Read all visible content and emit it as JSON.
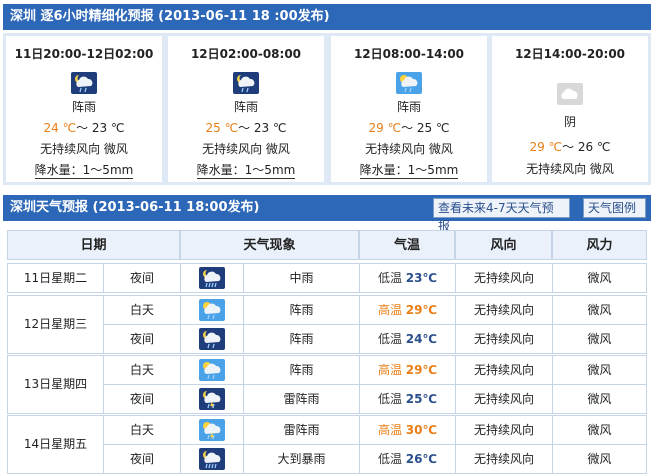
{
  "section1": {
    "title": "深圳  逐6小时精细化预报  (2013-06-11   18 :00发布)"
  },
  "periods": [
    {
      "time": "11日20:00-12日02:00",
      "weather": "阵雨",
      "temp_high": "24 ℃",
      "sep": "～",
      "temp_low": "23 ℃",
      "wind": "无持续风向 微风",
      "rain": "降水量：1～5mm",
      "icon": "shower-night-icon"
    },
    {
      "time": "12日02:00-08:00",
      "weather": "阵雨",
      "temp_high": "25 ℃",
      "sep": "～",
      "temp_low": "23 ℃",
      "wind": "无持续风向 微风",
      "rain": "降水量：1～5mm",
      "icon": "shower-night-icon"
    },
    {
      "time": "12日08:00-14:00",
      "weather": "阵雨",
      "temp_high": "29 ℃",
      "sep": "～",
      "temp_low": "25 ℃",
      "wind": "无持续风向 微风",
      "rain": "降水量：1～5mm",
      "icon": "shower-day-icon"
    },
    {
      "time": "12日14:00-20:00",
      "weather": "阴",
      "temp_high": "29 ℃",
      "sep": "～",
      "temp_low": "26 ℃",
      "wind": "无持续风向 微风",
      "rain": "",
      "icon": "overcast-icon"
    }
  ],
  "section2": {
    "title": "深圳天气预报  (2013-06-11  18:00发布)",
    "btn_forecast": "查看未来4-7天天气预报",
    "btn_legend": "天气图例"
  },
  "table": {
    "headers": [
      "日期",
      "天气现象",
      "气温",
      "风向",
      "风力"
    ],
    "days": [
      {
        "day": "11日星期二",
        "rows": [
          {
            "period": "夜间",
            "weather": "中雨",
            "temp_label": "低温",
            "temp": "23℃",
            "wind_dir": "无持续风向",
            "wind_force": "微风",
            "icon": "rain-night-icon",
            "high": false
          }
        ]
      },
      {
        "day": "12日星期三",
        "rows": [
          {
            "period": "白天",
            "weather": "阵雨",
            "temp_label": "高温",
            "temp": "29℃",
            "wind_dir": "无持续风向",
            "wind_force": "微风",
            "icon": "shower-day-icon",
            "high": true
          },
          {
            "period": "夜间",
            "weather": "阵雨",
            "temp_label": "低温",
            "temp": "24℃",
            "wind_dir": "无持续风向",
            "wind_force": "微风",
            "icon": "shower-night-icon",
            "high": false
          }
        ]
      },
      {
        "day": "13日星期四",
        "rows": [
          {
            "period": "白天",
            "weather": "阵雨",
            "temp_label": "高温",
            "temp": "29℃",
            "wind_dir": "无持续风向",
            "wind_force": "微风",
            "icon": "shower-day-icon",
            "high": true
          },
          {
            "period": "夜间",
            "weather": "雷阵雨",
            "temp_label": "低温",
            "temp": "25℃",
            "wind_dir": "无持续风向",
            "wind_force": "微风",
            "icon": "thunder-shower-night-icon",
            "high": false
          }
        ]
      },
      {
        "day": "14日星期五",
        "rows": [
          {
            "period": "白天",
            "weather": "雷阵雨",
            "temp_label": "高温",
            "temp": "30℃",
            "wind_dir": "无持续风向",
            "wind_force": "微风",
            "icon": "thunder-shower-day-icon",
            "high": true
          },
          {
            "period": "夜间",
            "weather": "大到暴雨",
            "temp_label": "低温",
            "temp": "26℃",
            "wind_dir": "无持续风向",
            "wind_force": "微风",
            "icon": "heavy-rain-night-icon",
            "high": false
          }
        ]
      }
    ]
  },
  "colors": {
    "header_blue": "#2d67b8",
    "high_temp": "#e87e15",
    "low_temp": "#2a4f8c"
  }
}
